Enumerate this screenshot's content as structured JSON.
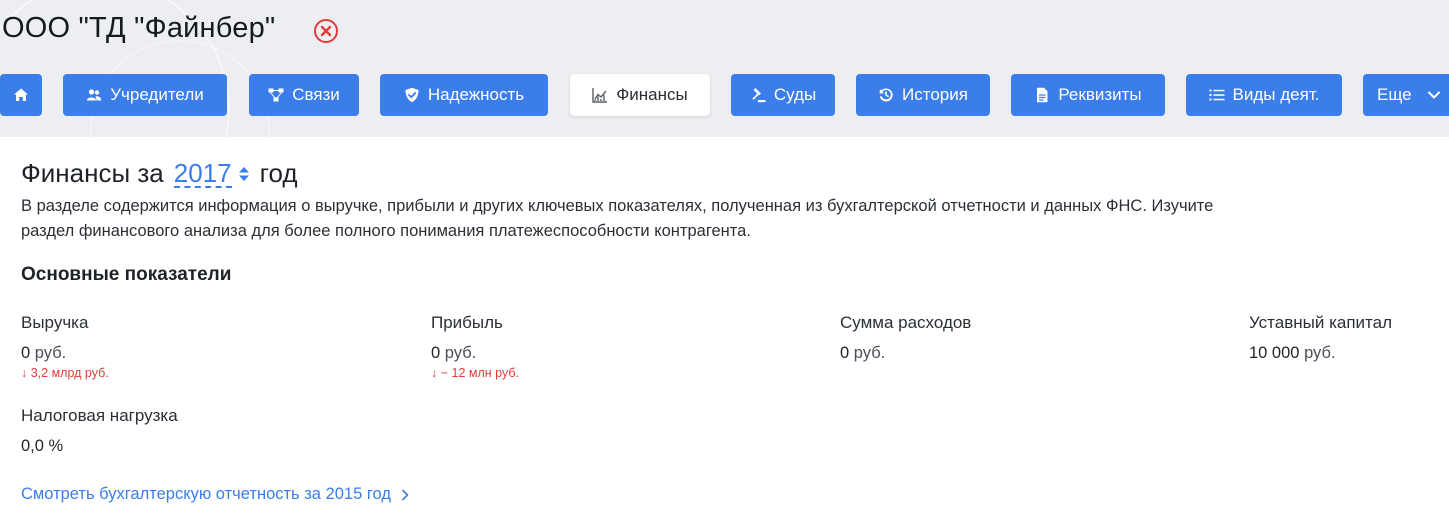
{
  "header": {
    "company_name": "ООО \"ТД \"Файнбер\"",
    "status_icon": "cancel-circle-icon",
    "status_color": "#e33b3b"
  },
  "nav": {
    "home_icon": "home-icon",
    "items": [
      {
        "label": "Учредители",
        "icon": "founders-icon"
      },
      {
        "label": "Связи",
        "icon": "connections-icon"
      },
      {
        "label": "Надежность",
        "icon": "shield-check-icon"
      },
      {
        "label": "Финансы",
        "icon": "chart-icon",
        "active": true
      },
      {
        "label": "Суды",
        "icon": "gavel-icon"
      },
      {
        "label": "История",
        "icon": "history-icon"
      },
      {
        "label": "Реквизиты",
        "icon": "document-icon"
      },
      {
        "label": "Виды деят.",
        "icon": "list-icon"
      },
      {
        "label": "Еще",
        "icon": "chevron-down-icon"
      }
    ],
    "accent_color": "#3b7de9"
  },
  "finance": {
    "title_prefix": "Финансы за",
    "year": "2017",
    "title_suffix": "год",
    "description": "В разделе содержится информация о выручке, прибыли и других ключевых показателях, полученная из бухгалтерской отчетности и данных ФНС. Изучите раздел финансового анализа для более полного понимания платежеспособности контрагента.",
    "section_title": "Основные показатели",
    "metrics": [
      {
        "label": "Выручка",
        "value": "0",
        "unit": "руб.",
        "change": "↓ 3,2 млрд руб."
      },
      {
        "label": "Прибыль",
        "value": "0",
        "unit": "руб.",
        "change": "↓ − 12 млн руб."
      },
      {
        "label": "Сумма расходов",
        "value": "0",
        "unit": "руб."
      },
      {
        "label": "Уставный капитал",
        "value": "10 000",
        "unit": "руб."
      },
      {
        "label": "Налоговая нагрузка",
        "value": "0,0 %"
      }
    ],
    "negative_color": "#e33b3b",
    "report_link": "Смотреть бухгалтерскую отчетность за 2015 год"
  }
}
